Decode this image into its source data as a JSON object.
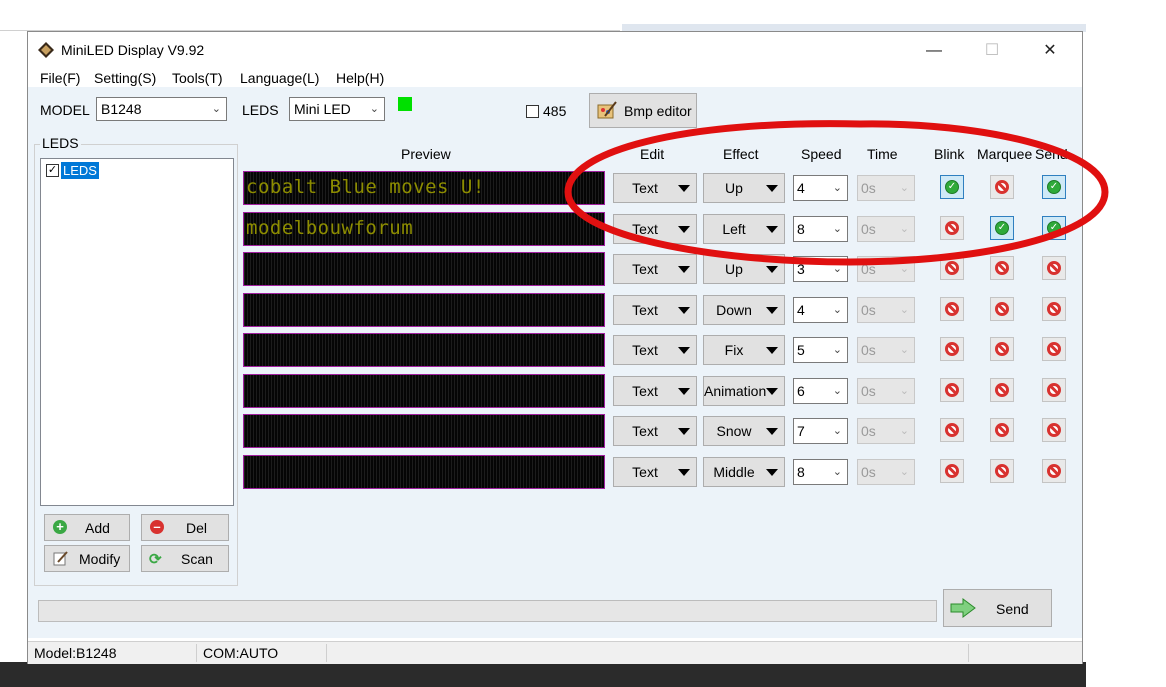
{
  "window": {
    "title": "MiniLED Display V9.92"
  },
  "menu": [
    "File(F)",
    "Setting(S)",
    "Tools(T)",
    "Language(L)",
    "Help(H)"
  ],
  "toolbar": {
    "model_label": "MODEL",
    "model_value": "B1248",
    "leds_label": "LEDS",
    "leds_value": "Mini LED",
    "indicator_color": "#00e000",
    "checkbox_485_label": "485",
    "bmp_editor_label": "Bmp editor"
  },
  "tree": {
    "group_label": "LEDS",
    "node_label": "LEDS"
  },
  "buttons": {
    "add": "Add",
    "del": "Del",
    "modify": "Modify",
    "scan": "Scan",
    "send": "Send"
  },
  "columns": {
    "preview": "Preview",
    "edit": "Edit",
    "effect": "Effect",
    "speed": "Speed",
    "time": "Time",
    "blink": "Blink",
    "marquee": "Marquee",
    "send": "Send"
  },
  "rows": [
    {
      "preview": "cobalt Blue moves  U!",
      "edit": "Text",
      "effect": "Up",
      "speed": "4",
      "time": "0s",
      "blink": true,
      "marquee": false,
      "send": true
    },
    {
      "preview": "modelbouwforum",
      "edit": "Text",
      "effect": "Left",
      "speed": "8",
      "time": "0s",
      "blink": false,
      "marquee": true,
      "send": true
    },
    {
      "preview": "",
      "edit": "Text",
      "effect": "Up",
      "speed": "3",
      "time": "0s",
      "blink": false,
      "marquee": false,
      "send": false
    },
    {
      "preview": "",
      "edit": "Text",
      "effect": "Down",
      "speed": "4",
      "time": "0s",
      "blink": false,
      "marquee": false,
      "send": false
    },
    {
      "preview": "",
      "edit": "Text",
      "effect": "Fix",
      "speed": "5",
      "time": "0s",
      "blink": false,
      "marquee": false,
      "send": false
    },
    {
      "preview": "",
      "edit": "Text",
      "effect": "Animation",
      "speed": "6",
      "time": "0s",
      "blink": false,
      "marquee": false,
      "send": false
    },
    {
      "preview": "",
      "edit": "Text",
      "effect": "Snow",
      "speed": "7",
      "time": "0s",
      "blink": false,
      "marquee": false,
      "send": false
    },
    {
      "preview": "",
      "edit": "Text",
      "effect": "Middle",
      "speed": "8",
      "time": "0s",
      "blink": false,
      "marquee": false,
      "send": false
    }
  ],
  "statusbar": {
    "model": "Model:B1248",
    "com": "COM:AUTO"
  },
  "annotation": {
    "color": "#e01010"
  }
}
